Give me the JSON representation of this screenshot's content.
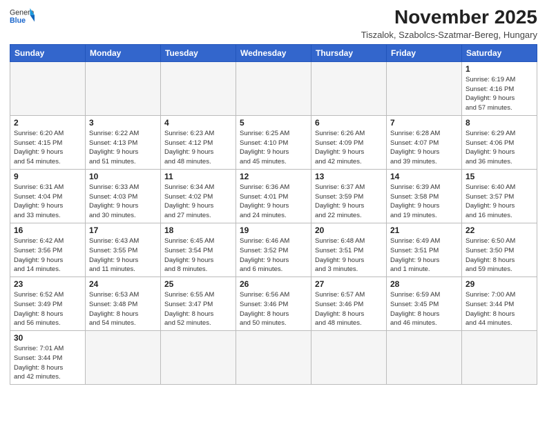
{
  "header": {
    "logo_general": "General",
    "logo_blue": "Blue",
    "month_title": "November 2025",
    "location": "Tiszalok, Szabolcs-Szatmar-Bereg, Hungary"
  },
  "weekdays": [
    "Sunday",
    "Monday",
    "Tuesday",
    "Wednesday",
    "Thursday",
    "Friday",
    "Saturday"
  ],
  "weeks": [
    [
      {
        "day": "",
        "info": ""
      },
      {
        "day": "",
        "info": ""
      },
      {
        "day": "",
        "info": ""
      },
      {
        "day": "",
        "info": ""
      },
      {
        "day": "",
        "info": ""
      },
      {
        "day": "",
        "info": ""
      },
      {
        "day": "1",
        "info": "Sunrise: 6:19 AM\nSunset: 4:16 PM\nDaylight: 9 hours\nand 57 minutes."
      }
    ],
    [
      {
        "day": "2",
        "info": "Sunrise: 6:20 AM\nSunset: 4:15 PM\nDaylight: 9 hours\nand 54 minutes."
      },
      {
        "day": "3",
        "info": "Sunrise: 6:22 AM\nSunset: 4:13 PM\nDaylight: 9 hours\nand 51 minutes."
      },
      {
        "day": "4",
        "info": "Sunrise: 6:23 AM\nSunset: 4:12 PM\nDaylight: 9 hours\nand 48 minutes."
      },
      {
        "day": "5",
        "info": "Sunrise: 6:25 AM\nSunset: 4:10 PM\nDaylight: 9 hours\nand 45 minutes."
      },
      {
        "day": "6",
        "info": "Sunrise: 6:26 AM\nSunset: 4:09 PM\nDaylight: 9 hours\nand 42 minutes."
      },
      {
        "day": "7",
        "info": "Sunrise: 6:28 AM\nSunset: 4:07 PM\nDaylight: 9 hours\nand 39 minutes."
      },
      {
        "day": "8",
        "info": "Sunrise: 6:29 AM\nSunset: 4:06 PM\nDaylight: 9 hours\nand 36 minutes."
      }
    ],
    [
      {
        "day": "9",
        "info": "Sunrise: 6:31 AM\nSunset: 4:04 PM\nDaylight: 9 hours\nand 33 minutes."
      },
      {
        "day": "10",
        "info": "Sunrise: 6:33 AM\nSunset: 4:03 PM\nDaylight: 9 hours\nand 30 minutes."
      },
      {
        "day": "11",
        "info": "Sunrise: 6:34 AM\nSunset: 4:02 PM\nDaylight: 9 hours\nand 27 minutes."
      },
      {
        "day": "12",
        "info": "Sunrise: 6:36 AM\nSunset: 4:01 PM\nDaylight: 9 hours\nand 24 minutes."
      },
      {
        "day": "13",
        "info": "Sunrise: 6:37 AM\nSunset: 3:59 PM\nDaylight: 9 hours\nand 22 minutes."
      },
      {
        "day": "14",
        "info": "Sunrise: 6:39 AM\nSunset: 3:58 PM\nDaylight: 9 hours\nand 19 minutes."
      },
      {
        "day": "15",
        "info": "Sunrise: 6:40 AM\nSunset: 3:57 PM\nDaylight: 9 hours\nand 16 minutes."
      }
    ],
    [
      {
        "day": "16",
        "info": "Sunrise: 6:42 AM\nSunset: 3:56 PM\nDaylight: 9 hours\nand 14 minutes."
      },
      {
        "day": "17",
        "info": "Sunrise: 6:43 AM\nSunset: 3:55 PM\nDaylight: 9 hours\nand 11 minutes."
      },
      {
        "day": "18",
        "info": "Sunrise: 6:45 AM\nSunset: 3:54 PM\nDaylight: 9 hours\nand 8 minutes."
      },
      {
        "day": "19",
        "info": "Sunrise: 6:46 AM\nSunset: 3:52 PM\nDaylight: 9 hours\nand 6 minutes."
      },
      {
        "day": "20",
        "info": "Sunrise: 6:48 AM\nSunset: 3:51 PM\nDaylight: 9 hours\nand 3 minutes."
      },
      {
        "day": "21",
        "info": "Sunrise: 6:49 AM\nSunset: 3:51 PM\nDaylight: 9 hours\nand 1 minute."
      },
      {
        "day": "22",
        "info": "Sunrise: 6:50 AM\nSunset: 3:50 PM\nDaylight: 8 hours\nand 59 minutes."
      }
    ],
    [
      {
        "day": "23",
        "info": "Sunrise: 6:52 AM\nSunset: 3:49 PM\nDaylight: 8 hours\nand 56 minutes."
      },
      {
        "day": "24",
        "info": "Sunrise: 6:53 AM\nSunset: 3:48 PM\nDaylight: 8 hours\nand 54 minutes."
      },
      {
        "day": "25",
        "info": "Sunrise: 6:55 AM\nSunset: 3:47 PM\nDaylight: 8 hours\nand 52 minutes."
      },
      {
        "day": "26",
        "info": "Sunrise: 6:56 AM\nSunset: 3:46 PM\nDaylight: 8 hours\nand 50 minutes."
      },
      {
        "day": "27",
        "info": "Sunrise: 6:57 AM\nSunset: 3:46 PM\nDaylight: 8 hours\nand 48 minutes."
      },
      {
        "day": "28",
        "info": "Sunrise: 6:59 AM\nSunset: 3:45 PM\nDaylight: 8 hours\nand 46 minutes."
      },
      {
        "day": "29",
        "info": "Sunrise: 7:00 AM\nSunset: 3:44 PM\nDaylight: 8 hours\nand 44 minutes."
      }
    ],
    [
      {
        "day": "30",
        "info": "Sunrise: 7:01 AM\nSunset: 3:44 PM\nDaylight: 8 hours\nand 42 minutes."
      },
      {
        "day": "",
        "info": ""
      },
      {
        "day": "",
        "info": ""
      },
      {
        "day": "",
        "info": ""
      },
      {
        "day": "",
        "info": ""
      },
      {
        "day": "",
        "info": ""
      },
      {
        "day": "",
        "info": ""
      }
    ]
  ]
}
